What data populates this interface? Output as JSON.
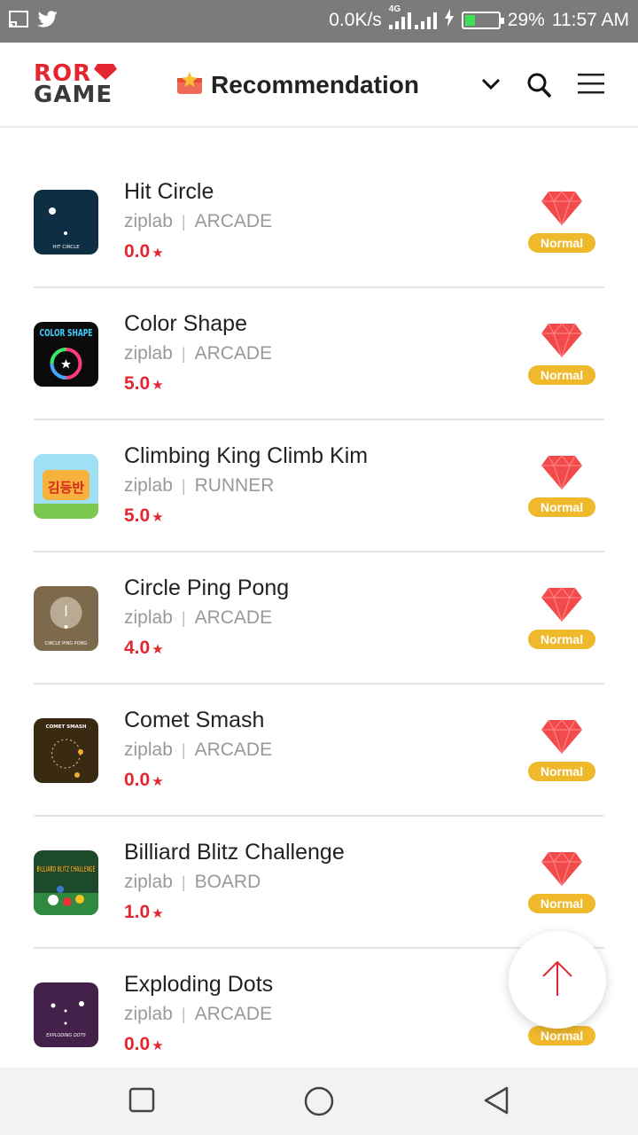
{
  "status_bar": {
    "speed": "0.0K/s",
    "network": "4G",
    "battery": "29%",
    "time": "11:57 AM",
    "icons": [
      "cast-icon",
      "twitter-icon",
      "signal-icon",
      "charging-icon",
      "battery-icon"
    ]
  },
  "header": {
    "logo_line1": "ROR",
    "logo_line2": "GAME",
    "title": "Recommendation",
    "icons": [
      "dropdown-chevron-icon",
      "search-icon",
      "menu-icon"
    ]
  },
  "colors": {
    "brand_red": "#e3262f",
    "badge_gold": "#f0b92c",
    "text_dark": "#222222",
    "text_muted": "#999999"
  },
  "games": [
    {
      "name": "Hit Circle",
      "developer": "ziplab",
      "category": "ARCADE",
      "rating": "0.0",
      "badge": "Normal",
      "thumb_label": "HIT CIRCLE"
    },
    {
      "name": "Color Shape",
      "developer": "ziplab",
      "category": "ARCADE",
      "rating": "5.0",
      "badge": "Normal",
      "thumb_label": "COLOR SHAPE"
    },
    {
      "name": "Climbing King Climb Kim",
      "developer": "ziplab",
      "category": "RUNNER",
      "rating": "5.0",
      "badge": "Normal",
      "thumb_label": "김등반"
    },
    {
      "name": "Circle Ping Pong",
      "developer": "ziplab",
      "category": "ARCADE",
      "rating": "4.0",
      "badge": "Normal",
      "thumb_label": "CIRCLE PING PONG"
    },
    {
      "name": "Comet Smash",
      "developer": "ziplab",
      "category": "ARCADE",
      "rating": "0.0",
      "badge": "Normal",
      "thumb_label": "COMET SMASH"
    },
    {
      "name": "Billiard Blitz Challenge",
      "developer": "ziplab",
      "category": "BOARD",
      "rating": "1.0",
      "badge": "Normal",
      "thumb_label": "BILLIARD BLITZ CHALLENGE"
    },
    {
      "name": "Exploding Dots",
      "developer": "ziplab",
      "category": "ARCADE",
      "rating": "0.0",
      "badge": "Normal",
      "thumb_label": "EXPLODING DOTS"
    }
  ],
  "fab": {
    "icon": "arrow-up-icon"
  },
  "nav_bar": {
    "icons": [
      "recents-square-icon",
      "home-circle-icon",
      "back-triangle-icon"
    ]
  }
}
